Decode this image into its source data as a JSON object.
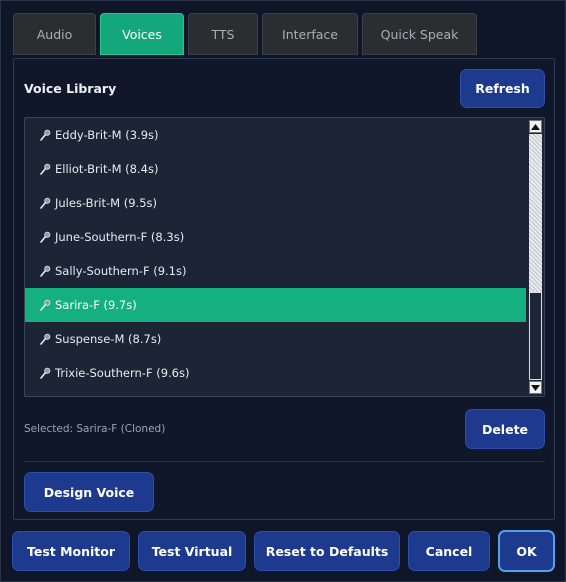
{
  "tabs": [
    {
      "label": "Audio",
      "active": false
    },
    {
      "label": "Voices",
      "active": true
    },
    {
      "label": "TTS",
      "active": false
    },
    {
      "label": "Interface",
      "active": false
    },
    {
      "label": "Quick Speak",
      "active": false
    }
  ],
  "voice_library": {
    "title": "Voice Library",
    "refresh_label": "Refresh",
    "delete_label": "Delete",
    "design_voice_label": "Design Voice",
    "selected_text": "Selected: Sarira-F (Cloned)",
    "items": [
      {
        "label": "Eddy-Brit-M (3.9s)",
        "icon": "microphone-icon"
      },
      {
        "label": "Elliot-Brit-M (8.4s)",
        "icon": "microphone-icon"
      },
      {
        "label": "Jules-Brit-M (9.5s)",
        "icon": "microphone-icon"
      },
      {
        "label": "June-Southern-F (8.3s)",
        "icon": "microphone-icon"
      },
      {
        "label": "Sally-Southern-F (9.1s)",
        "icon": "microphone-icon"
      },
      {
        "label": "Sarira-F (9.7s)",
        "icon": "microphone-icon",
        "selected": true
      },
      {
        "label": "Suspense-M (8.7s)",
        "icon": "microphone-icon"
      },
      {
        "label": "Trixie-Southern-F (9.6s)",
        "icon": "microphone-icon"
      }
    ]
  },
  "footer": {
    "test_monitor_label": "Test Monitor",
    "test_virtual_label": "Test Virtual",
    "reset_label": "Reset to Defaults",
    "cancel_label": "Cancel",
    "ok_label": "OK"
  },
  "colors": {
    "background": "#0e1627",
    "accent_green": "#15b07f",
    "button_blue": "#1d3a8f"
  }
}
